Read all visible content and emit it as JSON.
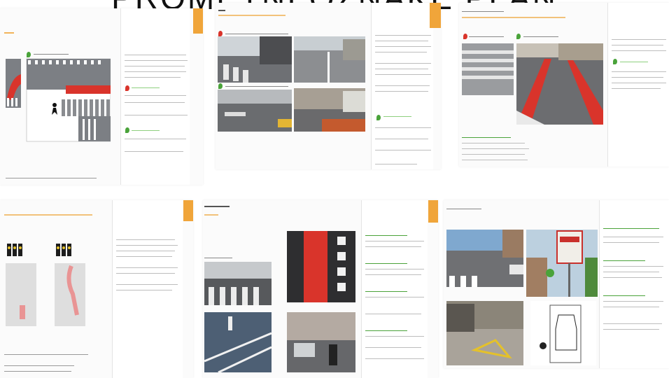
{
  "header": {
    "title": "PROMETNI OZNAKE PLAN"
  },
  "thumbnails": [
    {
      "name": "page-1"
    },
    {
      "name": "page-2"
    },
    {
      "name": "page-3"
    },
    {
      "name": "page-4"
    },
    {
      "name": "page-5"
    },
    {
      "name": "page-6"
    }
  ],
  "colors": {
    "accent": "#f0a53a",
    "bike_lane_red": "#d9342b",
    "green_icon": "#4aa33a",
    "asphalt": "#8a8c90"
  }
}
